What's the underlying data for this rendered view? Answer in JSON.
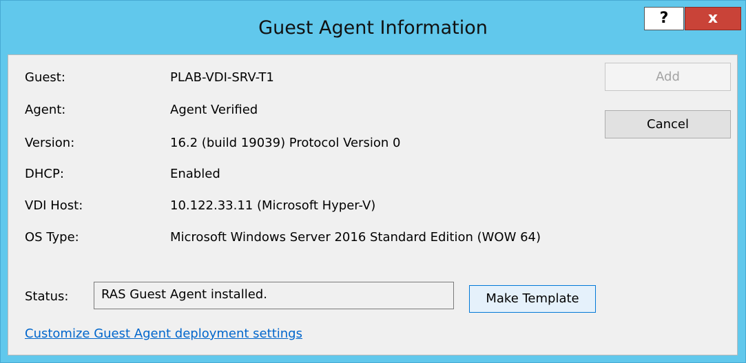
{
  "window": {
    "title": "Guest Agent Information",
    "help_label": "?",
    "close_label": "x"
  },
  "info": {
    "guest": {
      "label": "Guest:",
      "value": "PLAB-VDI-SRV-T1"
    },
    "agent": {
      "label": "Agent:",
      "value": "Agent Verified"
    },
    "version": {
      "label": "Version:",
      "value": "16.2 (build 19039) Protocol Version 0"
    },
    "dhcp": {
      "label": "DHCP:",
      "value": "Enabled"
    },
    "vdi_host": {
      "label": "VDI Host:",
      "value": "10.122.33.11 (Microsoft Hyper-V)"
    },
    "os_type": {
      "label": "OS Type:",
      "value": "Microsoft Windows Server 2016 Standard Edition (WOW 64)"
    }
  },
  "buttons": {
    "add": "Add",
    "cancel": "Cancel",
    "make_template": "Make Template"
  },
  "status": {
    "label": "Status:",
    "value": "RAS Guest Agent installed."
  },
  "link": {
    "text": "Customize Guest Agent deployment settings"
  },
  "colors": {
    "titlebar": "#61c8ec",
    "close_button": "#c94338",
    "link": "#0066cc",
    "focused_button_border": "#0078d7"
  }
}
